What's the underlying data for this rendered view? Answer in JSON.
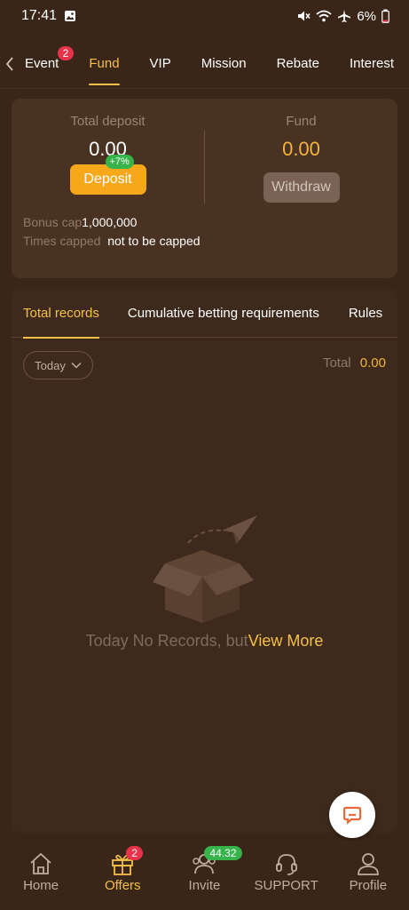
{
  "status_bar": {
    "time": "17:41",
    "battery": "6%"
  },
  "tabs": [
    {
      "label": "Event",
      "badge": "2"
    },
    {
      "label": "Fund"
    },
    {
      "label": "VIP"
    },
    {
      "label": "Mission"
    },
    {
      "label": "Rebate"
    },
    {
      "label": "Interest"
    }
  ],
  "fund": {
    "total_deposit_label": "Total deposit",
    "total_deposit_value": "0.00",
    "deposit_button": "Deposit",
    "deposit_bonus": "+7%",
    "fund_label": "Fund",
    "fund_value": "0.00",
    "withdraw_button": "Withdraw",
    "bonus_cap_label": "Bonus cap",
    "bonus_cap_value": "1,000,000",
    "times_capped_label": "Times capped",
    "times_capped_value": "not to be capped"
  },
  "records": {
    "tabs": [
      {
        "label": "Total records"
      },
      {
        "label": "Cumulative betting requirements"
      },
      {
        "label": "Rules"
      }
    ],
    "filter": "Today",
    "total_label": "Total",
    "total_value": "0.00",
    "empty_text": "Today No Records, but",
    "view_more": "View More"
  },
  "bottom_nav": [
    {
      "label": "Home",
      "icon": "home-icon"
    },
    {
      "label": "Offers",
      "icon": "gift-icon",
      "badge": "2"
    },
    {
      "label": "Invite",
      "icon": "invite-icon",
      "badge": "44.32"
    },
    {
      "label": "SUPPORT",
      "icon": "headset-icon"
    },
    {
      "label": "Profile",
      "icon": "profile-icon"
    }
  ],
  "colors": {
    "background": "#3a2618",
    "accent": "#f4c04a",
    "deposit": "#f6a81a",
    "badge_red": "#e8334a",
    "badge_green": "#36b34a"
  }
}
